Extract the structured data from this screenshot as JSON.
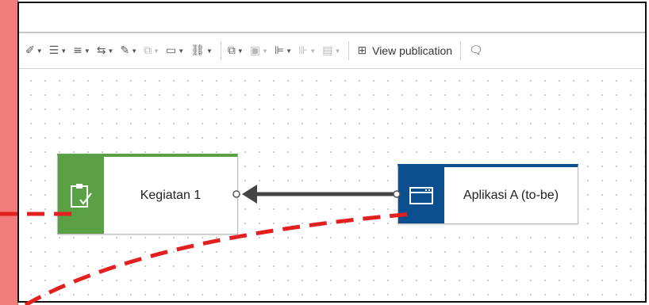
{
  "toolbar": {
    "items": [
      {
        "icon": "fill-color-icon",
        "glyph": "✐",
        "disabled": false
      },
      {
        "icon": "line-style-icon",
        "glyph": "☰",
        "disabled": false
      },
      {
        "icon": "line-weight-icon",
        "glyph": "≡",
        "disabled": false
      },
      {
        "icon": "connector-arrows-icon",
        "glyph": "⇆",
        "disabled": false
      },
      {
        "icon": "edit-shape-icon",
        "glyph": "✎",
        "disabled": false
      },
      {
        "icon": "shape-style-icon",
        "glyph": "⧉",
        "disabled": true
      },
      {
        "icon": "shape-type-icon",
        "glyph": "▭",
        "disabled": false
      },
      {
        "icon": "link-icon",
        "glyph": "⛓",
        "disabled": false
      }
    ],
    "items2": [
      {
        "icon": "arrange-icon",
        "glyph": "⧉",
        "disabled": false
      },
      {
        "icon": "group-icon",
        "glyph": "▣",
        "disabled": true
      },
      {
        "icon": "align-icon",
        "glyph": "⊫",
        "disabled": false
      },
      {
        "icon": "distribute-icon",
        "glyph": "⊪",
        "disabled": true
      },
      {
        "icon": "size-icon",
        "glyph": "▤",
        "disabled": true
      }
    ],
    "view_publication_label": "View publication"
  },
  "diagram": {
    "node_a": {
      "label": "Kegiatan 1",
      "color": "#5aa145",
      "icon": "clipboard-check-icon"
    },
    "node_b": {
      "label": "Aplikasi A (to-be)",
      "color": "#0c4f8e",
      "icon": "application-window-icon"
    }
  },
  "annotation": {
    "color": "#e32020"
  }
}
